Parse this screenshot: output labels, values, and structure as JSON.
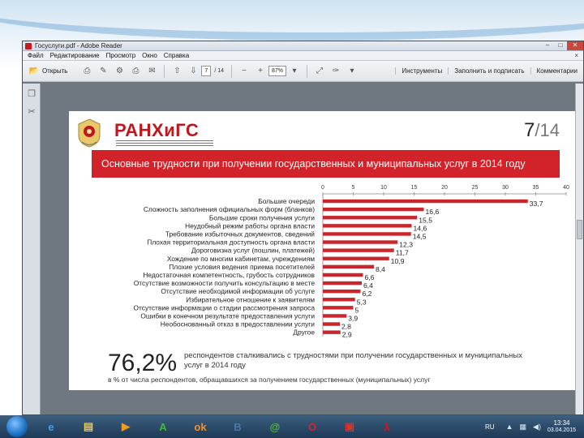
{
  "window": {
    "title": "Госуслуги.pdf - Adobe Reader",
    "controls": {
      "minimize": "–",
      "maximize": "□",
      "close": "✕"
    }
  },
  "menu": {
    "items": [
      "Файл",
      "Редактирование",
      "Просмотр",
      "Окно",
      "Справка"
    ],
    "close_label": "×"
  },
  "toolbar": {
    "open_label": "Открыть",
    "page_current": "7",
    "page_total": "/ 14",
    "zoom": "87%",
    "tools_label": "Инструменты",
    "fill_sign_label": "Заполнить и подписать",
    "comments_label": "Комментарии"
  },
  "slide": {
    "brand": "РАНХиГС",
    "page_current": "7",
    "page_total": "/14",
    "headline": "Основные трудности при получении государственных и муниципальных услуг в 2014 году",
    "big_percent": "76,2%",
    "summary_line_1": "респондентов сталкивались с трудностями при получении государственных и муниципальных услуг в 2014 году",
    "summary_line_2": "в % от числа респондентов, обращавшихся за получением государственных (муниципальных) услуг"
  },
  "chart_data": {
    "type": "bar",
    "orientation": "horizontal",
    "xlim": [
      0,
      40
    ],
    "ticks": [
      0,
      5,
      10,
      15,
      20,
      25,
      30,
      35,
      40
    ],
    "bar_color": "#c9272d",
    "categories": [
      "Большие очереди",
      "Сложность заполнения официальных форм (бланков)",
      "Большие сроки получения услуги",
      "Неудобный режим работы органа власти",
      "Требование избыточных документов, сведений",
      "Плохая территориальная доступность органа власти",
      "Дороговизна услуг (пошлин, платежей)",
      "Хождение по многим кабинетам, учреждениям",
      "Плохие условия ведения приема посетителей",
      "Недостаточная компетентность, грубость сотрудников",
      "Отсутствие возможности получить консультацию в месте",
      "Отсутствие необходимой информации об услуге",
      "Избирательное отношение к заявителям",
      "Отсутствие информации о стадии рассмотрения запроса",
      "Ошибки в конечном результате предоставления услуги",
      "Необоснованный отказ в предоставлении услуги",
      "Другое"
    ],
    "values": [
      33.7,
      16.6,
      15.5,
      14.6,
      14.5,
      12.3,
      11.7,
      10.9,
      8.4,
      6.6,
      6.4,
      6.2,
      5.3,
      5,
      3.9,
      2.8,
      2.9
    ],
    "value_labels": [
      "33,7",
      "16,6",
      "15,5",
      "14,6",
      "14,5",
      "12,3",
      "11,7",
      "10,9",
      "8,4",
      "6,6",
      "6,4",
      "6,2",
      "5,3",
      "5",
      "3,9",
      "2,8",
      "2,9"
    ]
  },
  "taskbar": {
    "apps": [
      {
        "name": "internet-explorer",
        "glyph": "e",
        "color": "#3ba1e8"
      },
      {
        "name": "file-explorer",
        "glyph": "▤",
        "color": "#f0c542"
      },
      {
        "name": "media-player",
        "glyph": "▶",
        "color": "#f29a1d"
      },
      {
        "name": "a-app",
        "glyph": "A",
        "color": "#44b934"
      },
      {
        "name": "odnoklassniki",
        "glyph": "ok",
        "color": "#f59122"
      },
      {
        "name": "vkontakte",
        "glyph": "B",
        "color": "#4b77a8"
      },
      {
        "name": "icq",
        "glyph": "@",
        "color": "#4fbb3c"
      },
      {
        "name": "opera",
        "glyph": "O",
        "color": "#e02128"
      },
      {
        "name": "media-app",
        "glyph": "▣",
        "color": "#d9342b"
      },
      {
        "name": "adobe-reader",
        "glyph": "λ",
        "color": "#d3171e"
      }
    ],
    "lang": "RU",
    "time": "13:34",
    "date": "03.04.2015"
  }
}
